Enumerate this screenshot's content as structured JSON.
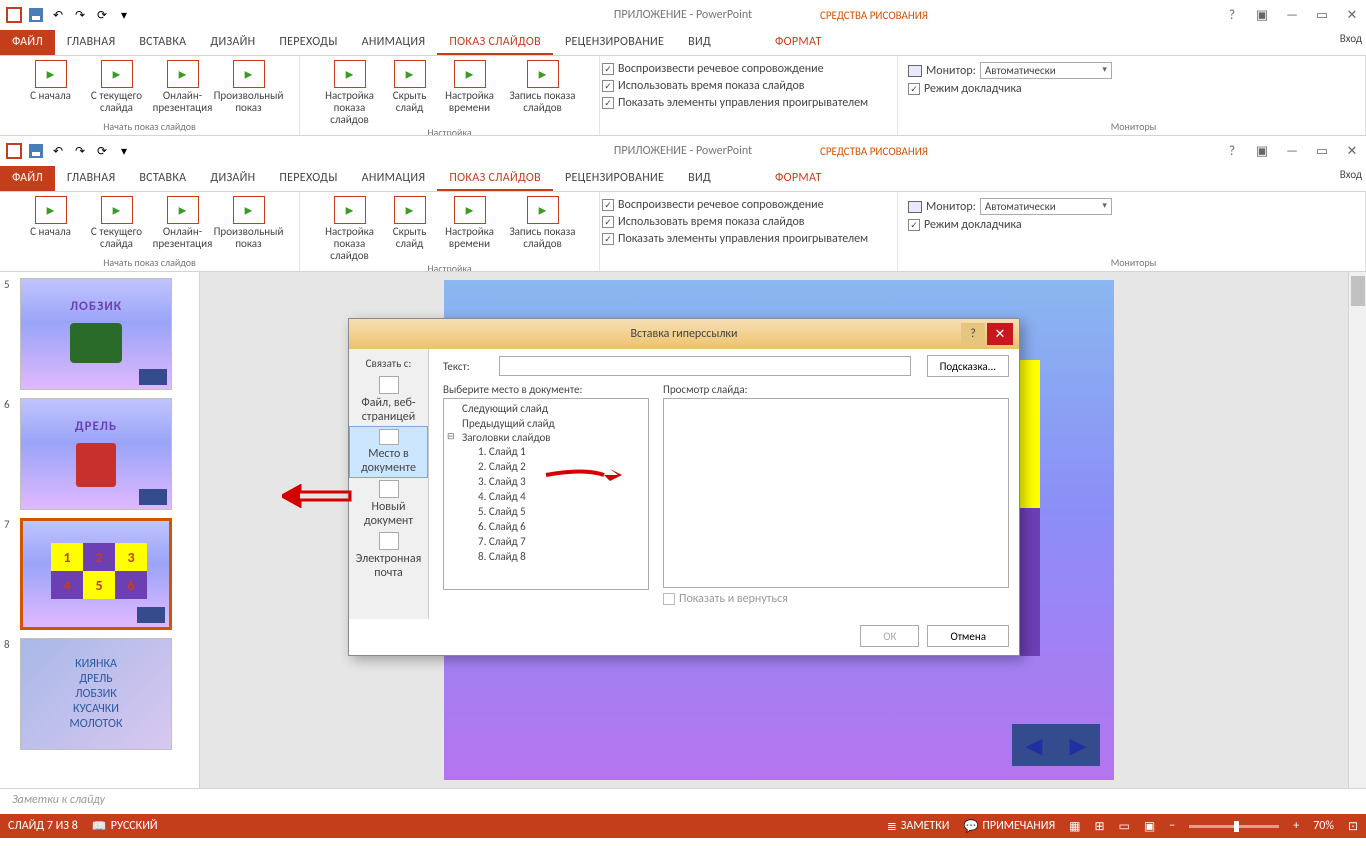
{
  "title_app": "ПРИЛОЖЕНИЕ  - PowerPoint",
  "tool_context": "СРЕДСТВА РИСОВАНИЯ",
  "sign_in": "Вход",
  "tabs": {
    "file": "ФАЙЛ",
    "home": "ГЛАВНАЯ",
    "insert": "ВСТАВКА",
    "design": "ДИЗАЙН",
    "transitions": "ПЕРЕХОДЫ",
    "animations": "АНИМАЦИЯ",
    "slideshow": "ПОКАЗ СЛАЙДОВ",
    "review": "РЕЦЕНЗИРОВАНИЕ",
    "view": "ВИД",
    "format": "ФОРМАТ"
  },
  "ribbon": {
    "from_start": "С\nначала",
    "from_current": "С текущего\nслайда",
    "online": "Онлайн-\nпрезентация",
    "custom": "Произвольный\nпоказ",
    "setup": "Настройка\nпоказа слайдов",
    "hide": "Скрыть\nслайд",
    "rehearse": "Настройка\nвремени",
    "record": "Запись показа\nслайдов",
    "cb_narr": "Воспроизвести речевое сопровождение",
    "cb_timings": "Использовать время показа слайдов",
    "cb_media": "Показать элементы управления проигрывателем",
    "monitor_lbl": "Монитор:",
    "monitor_val": "Автоматически",
    "presenter": "Режим докладчика",
    "grp_start": "Начать показ слайдов",
    "grp_setup": "Настройка",
    "grp_monitors": "Мониторы"
  },
  "thumbs": {
    "5": "ЛОБЗИК",
    "6": "ДРЕЛЬ",
    "7_cells": [
      "1",
      "2",
      "3",
      "4",
      "5",
      "6"
    ],
    "8_words": [
      "КИЯНКА",
      "ДРЕЛЬ",
      "ЛОБЗИК",
      "КУСАЧКИ",
      "МОЛОТОК"
    ]
  },
  "dlg": {
    "title": "Вставка гиперссылки",
    "link_hdr": "Связать с:",
    "text_lbl": "Текст:",
    "hint_btn": "Подсказка...",
    "opt_file": "Файл, веб-\nстраницей",
    "opt_place": "Место в\nдокументе",
    "opt_new": "Новый\nдокумент",
    "opt_mail": "Электронная\nпочта",
    "choose_lbl": "Выберите место в документе:",
    "preview_lbl": "Просмотр слайда:",
    "tree_next": "Следующий слайд",
    "tree_prev": "Предыдущий слайд",
    "tree_hdrs": "Заголовки слайдов",
    "slides": [
      "1. Слайд 1",
      "2. Слайд 2",
      "3. Слайд 3",
      "4. Слайд 4",
      "5. Слайд 5",
      "6. Слайд 6",
      "7. Слайд 7",
      "8. Слайд 8"
    ],
    "show_return": "Показать и вернуться",
    "ok": "ОК",
    "cancel": "Отмена"
  },
  "notes_placeholder": "Заметки к слайду",
  "status": {
    "slide": "СЛАЙД 7 ИЗ 8",
    "lang": "РУССКИЙ",
    "notes": "ЗАМЕТКИ",
    "comments": "ПРИМЕЧАНИЯ",
    "zoom": "70%"
  }
}
